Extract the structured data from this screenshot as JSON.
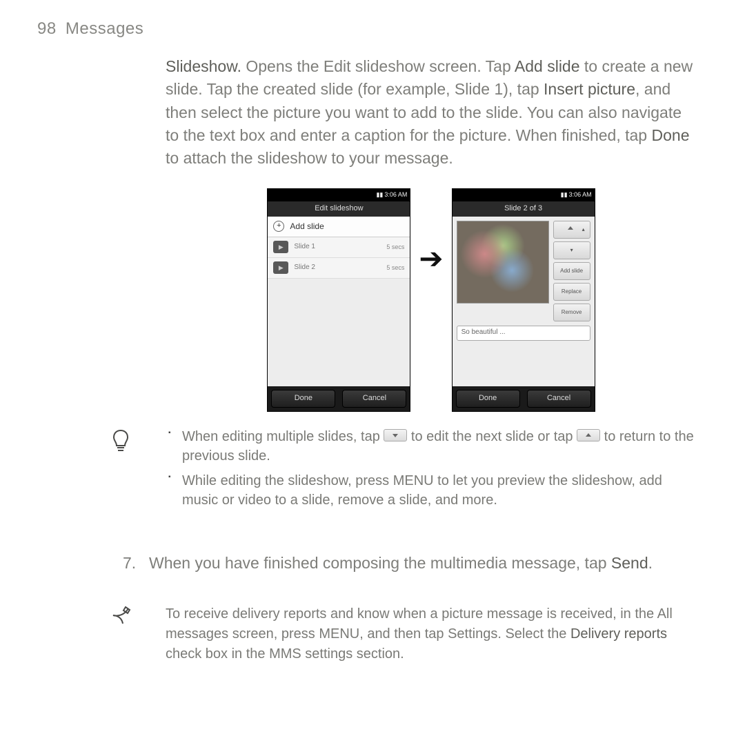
{
  "header": {
    "page_number": "98",
    "section": "Messages"
  },
  "paragraph": {
    "slideshow_term": "Slideshow.",
    "p1a": " Opens the Edit slideshow screen. Tap ",
    "add_slide": "Add slide",
    "p1b": " to create a new slide. Tap the created slide (for example, Slide 1), tap ",
    "insert_picture": "Insert picture",
    "p1c": ", and then select the picture you want to add to the slide. You can also navigate to the text box and enter a caption for the picture. When finished, tap ",
    "done_term": "Done",
    "p1d": " to attach the slideshow to your message."
  },
  "phone_left": {
    "time": "3:06 AM",
    "title": "Edit slideshow",
    "add_slide": "Add slide",
    "slides": [
      {
        "name": "Slide 1",
        "secs": "5 secs"
      },
      {
        "name": "Slide 2",
        "secs": "5 secs"
      }
    ],
    "done": "Done",
    "cancel": "Cancel"
  },
  "phone_right": {
    "time": "3:06 AM",
    "title": "Slide 2 of 3",
    "btn_add": "Add slide",
    "btn_replace": "Replace",
    "btn_remove": "Remove",
    "caption": "So beautiful ...",
    "done": "Done",
    "cancel": "Cancel"
  },
  "tips": {
    "t1a": "When editing multiple slides, tap ",
    "t1b": " to edit the next slide or tap ",
    "t1c": " to return to the previous slide.",
    "t2": "While editing the slideshow, press MENU to let you preview the slideshow, add music or video to a slide, remove a slide, and more."
  },
  "step7": {
    "num": "7.",
    "text_a": "When you have finished composing the multimedia message, tap ",
    "send": "Send",
    "text_b": "."
  },
  "note": {
    "a": "To receive delivery reports and know when a picture message is received, in the All messages screen, press MENU, and then tap Settings. Select the ",
    "delivery": "Delivery reports",
    "b": " check box in the MMS settings section."
  }
}
